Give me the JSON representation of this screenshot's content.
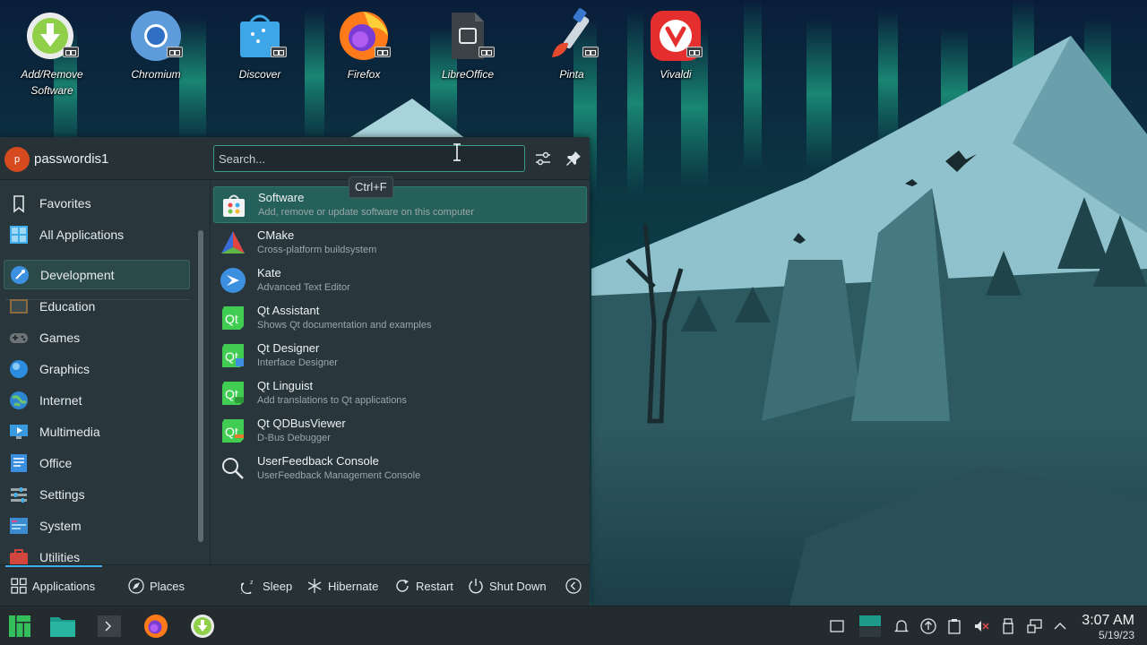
{
  "desktop": {
    "icons": [
      {
        "label": "Add/Remove\nSoftware",
        "icon": "add-remove-software-icon"
      },
      {
        "label": "Chromium",
        "icon": "chromium-icon"
      },
      {
        "label": "Discover",
        "icon": "discover-icon"
      },
      {
        "label": "Firefox",
        "icon": "firefox-icon"
      },
      {
        "label": "LibreOffice",
        "icon": "libreoffice-icon"
      },
      {
        "label": "Pinta",
        "icon": "pinta-icon"
      },
      {
        "label": "Vivaldi",
        "icon": "vivaldi-icon"
      }
    ]
  },
  "launcher": {
    "user": {
      "initial": "p",
      "name": "passwordis1"
    },
    "search": {
      "placeholder": "Search...",
      "value": ""
    },
    "tooltip": "Ctrl+F",
    "categories": [
      {
        "label": "Favorites",
        "icon": "bookmark-icon"
      },
      {
        "label": "All Applications",
        "icon": "grid-icon"
      },
      {
        "label": "Development",
        "icon": "development-icon",
        "active": true
      },
      {
        "label": "Education",
        "icon": "education-icon"
      },
      {
        "label": "Games",
        "icon": "gamepad-icon"
      },
      {
        "label": "Graphics",
        "icon": "graphics-icon"
      },
      {
        "label": "Internet",
        "icon": "globe-icon"
      },
      {
        "label": "Multimedia",
        "icon": "multimedia-icon"
      },
      {
        "label": "Office",
        "icon": "office-icon"
      },
      {
        "label": "Settings",
        "icon": "settings-icon"
      },
      {
        "label": "System",
        "icon": "system-icon"
      },
      {
        "label": "Utilities",
        "icon": "utilities-icon"
      }
    ],
    "apps": [
      {
        "name": "Software",
        "desc": "Add, remove or update software on this computer",
        "icon": "software-icon",
        "active": true
      },
      {
        "name": "CMake",
        "desc": "Cross-platform buildsystem",
        "icon": "cmake-icon"
      },
      {
        "name": "Kate",
        "desc": "Advanced Text Editor",
        "icon": "kate-icon"
      },
      {
        "name": "Qt Assistant",
        "desc": "Shows Qt documentation and examples",
        "icon": "qt-assistant-icon"
      },
      {
        "name": "Qt Designer",
        "desc": "Interface Designer",
        "icon": "qt-designer-icon"
      },
      {
        "name": "Qt Linguist",
        "desc": "Add translations to Qt applications",
        "icon": "qt-linguist-icon"
      },
      {
        "name": "Qt QDBusViewer",
        "desc": "D-Bus Debugger",
        "icon": "qt-qdbusviewer-icon"
      },
      {
        "name": "UserFeedback Console",
        "desc": "UserFeedback Management Console",
        "icon": "search-magnifier-icon"
      }
    ],
    "footer": {
      "applications": "Applications",
      "places": "Places",
      "sleep": "Sleep",
      "hibernate": "Hibernate",
      "restart": "Restart",
      "shutdown": "Shut Down"
    }
  },
  "taskbar": {
    "clock": {
      "time": "3:07 AM",
      "date": "5/19/23"
    }
  },
  "colors": {
    "accent": "#3daee9",
    "selection": "#26605a",
    "panel": "#29373c"
  }
}
